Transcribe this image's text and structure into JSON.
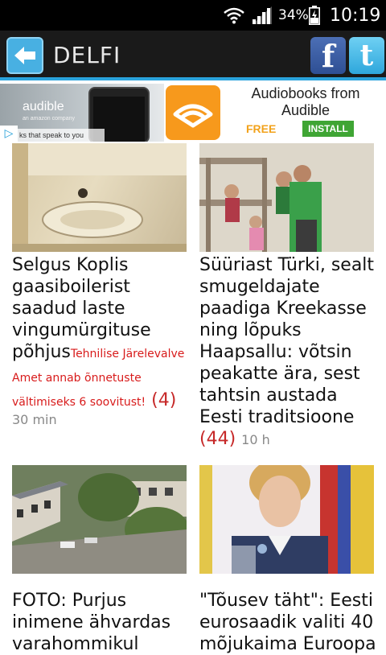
{
  "status_bar": {
    "battery_percent": "34%",
    "time": "10:19"
  },
  "app_bar": {
    "title": "DELFI"
  },
  "ad": {
    "brand": "audible",
    "brand_sub": "an amazon company",
    "tagline": "ks that speak to you",
    "headline": "Audiobooks from Audible",
    "free_label": "FREE",
    "install_label": "INSTALL"
  },
  "articles": [
    {
      "title": "Selgus Koplis gaasiboilerist saadud laste vingumürgituse põhjus",
      "subtitle": "Tehnilise Järelevalve Amet annab õnnetuste vältimiseks 6 soovitust!",
      "comments": "(4)",
      "time": "30 min"
    },
    {
      "title": "Süüriast Türki, sealt smugeldajate paadiga Kreekasse ning lõpuks Haapsallu: võtsin peakatte ära, sest tahtsin austada Eesti traditsioone",
      "comments": "(44)",
      "time": "10 h"
    },
    {
      "title": "FOTO: Purjus inimene ähvardas varahommikul"
    },
    {
      "title": "\"Tõusev täht\": Eesti eurosaadik valiti 40 mõjukaima Euroopa"
    }
  ]
}
